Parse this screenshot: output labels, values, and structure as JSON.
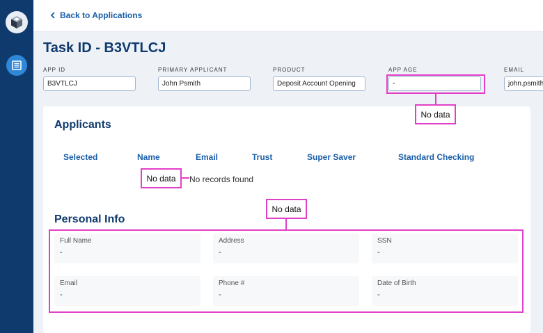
{
  "nav": {
    "back_label": "Back to Applications"
  },
  "page": {
    "title": "Task ID - B3VTLCJ"
  },
  "fields": [
    {
      "label": "APP ID",
      "value": "B3VTLCJ"
    },
    {
      "label": "PRIMARY APPLICANT",
      "value": "John Psmith"
    },
    {
      "label": "PRODUCT",
      "value": "Deposit Account Opening"
    },
    {
      "label": "APP AGE",
      "value": "-"
    },
    {
      "label": "EMAIL",
      "value": "john.psmith"
    }
  ],
  "applicants": {
    "title": "Applicants",
    "columns": [
      "Selected",
      "Name",
      "Email",
      "Trust",
      "Super Saver",
      "Standard Checking"
    ],
    "empty_text": "No records found"
  },
  "personal_info": {
    "title": "Personal Info",
    "items": [
      {
        "label": "Full Name",
        "value": "-"
      },
      {
        "label": "Address",
        "value": "-"
      },
      {
        "label": "SSN",
        "value": "-"
      },
      {
        "label": "Email",
        "value": "-"
      },
      {
        "label": "Phone #",
        "value": "-"
      },
      {
        "label": "Date of Birth",
        "value": "-"
      }
    ]
  },
  "annotations": {
    "no_data_label": "No data"
  },
  "colors": {
    "sidebar": "#0f3a6d",
    "accent": "#1a5ea8",
    "annotation": "#e23fc8"
  }
}
